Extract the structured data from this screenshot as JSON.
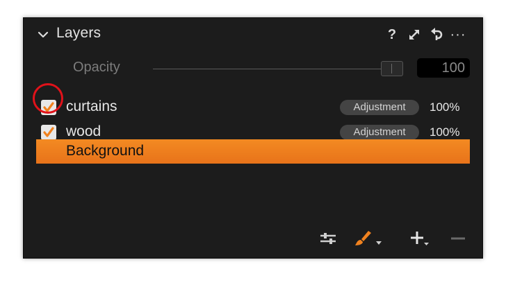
{
  "panel": {
    "title": "Layers",
    "icons": [
      "chevron-down-icon",
      "help-icon",
      "expand-icon",
      "reset-icon",
      "more-icon"
    ]
  },
  "opacity": {
    "label": "Opacity",
    "value": "100",
    "slider_level": 1.0
  },
  "layers": [
    {
      "name": "curtains",
      "checked": true,
      "type": "Adjustment",
      "opacity": "100%"
    },
    {
      "name": "wood",
      "checked": true,
      "type": "Adjustment",
      "opacity": "100%"
    },
    {
      "name": "Background",
      "selected": true
    }
  ],
  "toolbar": {
    "icons": [
      "adjustments-icon",
      "brush-icon",
      "add-layer-icon",
      "remove-layer-icon"
    ]
  },
  "colors": {
    "accent": "#f0821f",
    "panel_bg": "#1c1c1c",
    "annotation": "#e0121a"
  }
}
